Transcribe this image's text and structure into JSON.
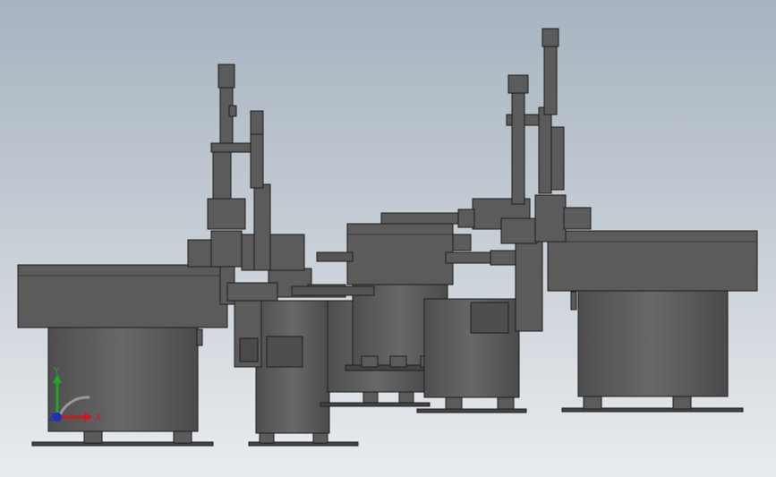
{
  "viewport": {
    "background_top": "#a7b3c0",
    "background_bottom": "#e9ecef",
    "model_color": "#5b5b5b",
    "edge_color": "#1e1e1e"
  },
  "triad": {
    "x_label": "X",
    "y_label": "Y",
    "z_label": "Z",
    "x_color": "#d2161b",
    "y_color": "#22a52a",
    "z_color": "#1c2fbf"
  }
}
